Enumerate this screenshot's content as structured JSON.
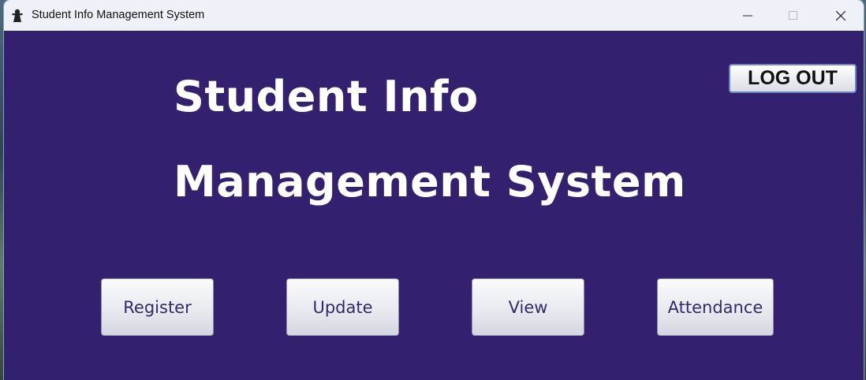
{
  "window": {
    "title": "Student Info Management System",
    "icon": "app-figure-icon",
    "controls": [
      "minimize-icon",
      "maximize-icon",
      "close-icon"
    ]
  },
  "heading": {
    "line1": "Student Info",
    "line2": "Management System"
  },
  "logout": {
    "label": "LOG OUT"
  },
  "actions": [
    {
      "label": "Register"
    },
    {
      "label": "Update"
    },
    {
      "label": "View"
    },
    {
      "label": "Attendance"
    }
  ],
  "colors": {
    "background": "#33216f",
    "heading_text": "#ffffff",
    "button_text": "#2f2a6a",
    "titlebar": "#eef2f8"
  }
}
